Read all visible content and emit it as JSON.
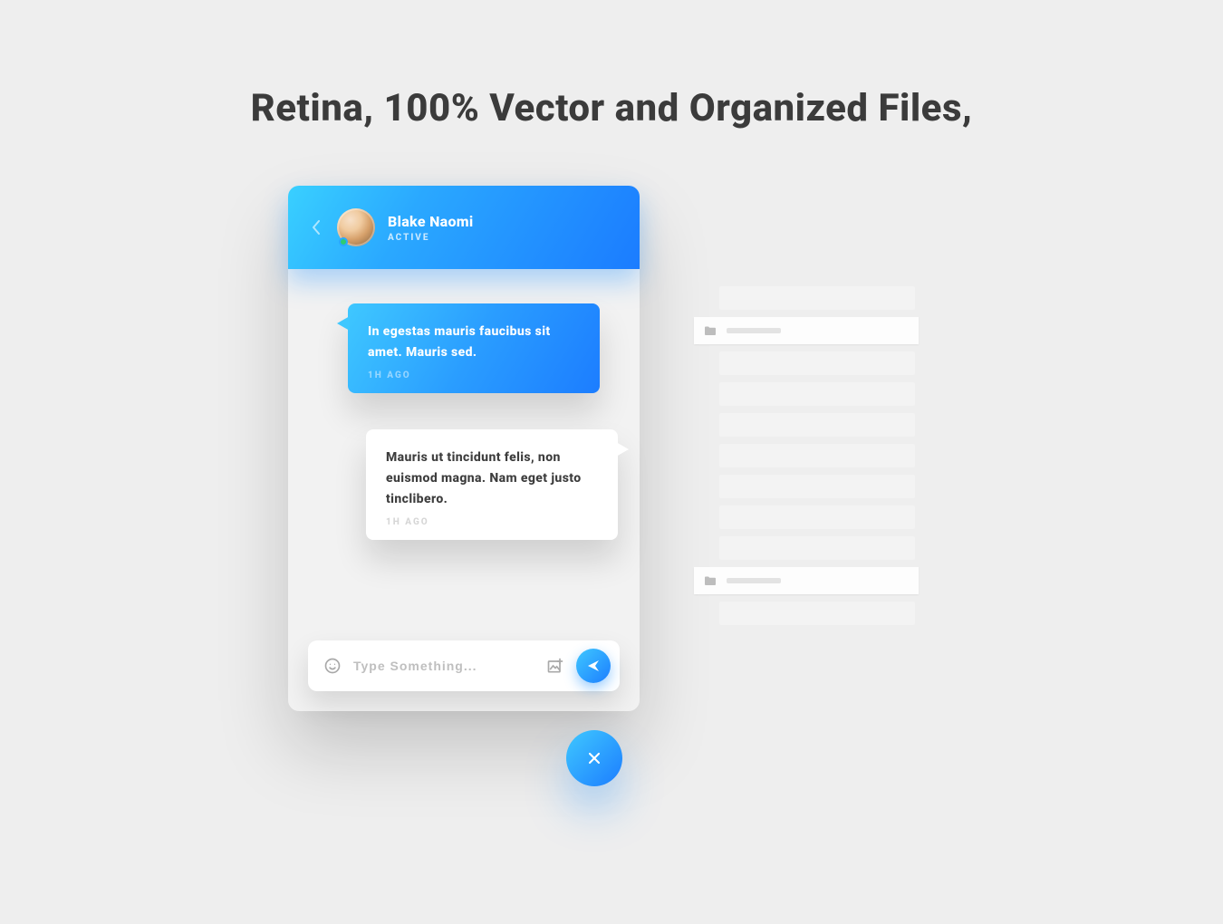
{
  "headline": "Retina, 100% Vector and Organized Files,",
  "chat": {
    "contact": {
      "name": "Blake Naomi",
      "status": "ACTIVE"
    },
    "messages": [
      {
        "direction": "incoming",
        "text": "In egestas mauris faucibus sit amet. Mauris sed.",
        "time": "1H AGO"
      },
      {
        "direction": "outgoing",
        "text": "Mauris ut tincidunt felis, non euismod magna. Nam eget justo tinclibero.",
        "time": "1H AGO"
      }
    ],
    "input": {
      "placeholder": "Type Something..."
    }
  },
  "colors": {
    "accent_start": "#3fc8ff",
    "accent_end": "#1c7dff",
    "status_active": "#2ecc71"
  }
}
